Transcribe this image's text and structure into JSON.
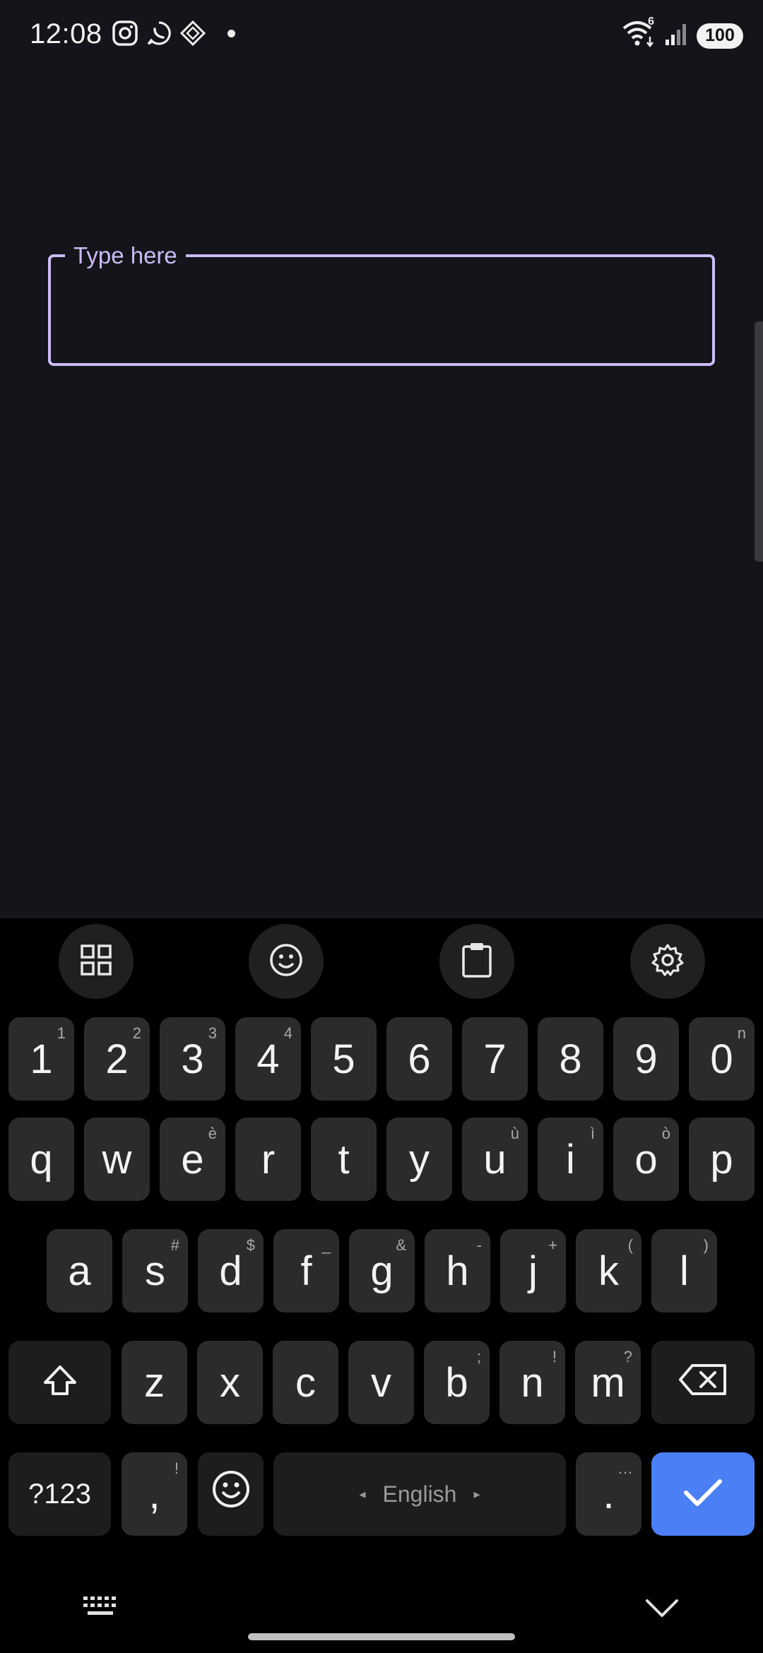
{
  "status_bar": {
    "time": "12:08",
    "battery": "100",
    "wifi_badge": "6",
    "left_icons": [
      "instagram-icon",
      "whatsapp-icon",
      "diamond-app-icon",
      "notification-dot"
    ],
    "right_icons": [
      "wifi-icon",
      "signal-icon",
      "battery-icon"
    ]
  },
  "text_field": {
    "label": "Type here",
    "value": ""
  },
  "keyboard": {
    "toolbar": [
      "grid-icon",
      "emoji-icon",
      "clipboard-icon",
      "settings-icon"
    ],
    "row_numbers": [
      {
        "label": "1",
        "hint": "1"
      },
      {
        "label": "2",
        "hint": "2"
      },
      {
        "label": "3",
        "hint": "3"
      },
      {
        "label": "4",
        "hint": "4"
      },
      {
        "label": "5",
        "hint": ""
      },
      {
        "label": "6",
        "hint": ""
      },
      {
        "label": "7",
        "hint": ""
      },
      {
        "label": "8",
        "hint": ""
      },
      {
        "label": "9",
        "hint": ""
      },
      {
        "label": "0",
        "hint": "n"
      }
    ],
    "row_top": [
      {
        "label": "q",
        "hint": ""
      },
      {
        "label": "w",
        "hint": ""
      },
      {
        "label": "e",
        "hint": "è"
      },
      {
        "label": "r",
        "hint": ""
      },
      {
        "label": "t",
        "hint": ""
      },
      {
        "label": "y",
        "hint": ""
      },
      {
        "label": "u",
        "hint": "ù"
      },
      {
        "label": "i",
        "hint": "ì"
      },
      {
        "label": "o",
        "hint": "ò"
      },
      {
        "label": "p",
        "hint": ""
      }
    ],
    "row_middle": [
      {
        "label": "a",
        "hint": ""
      },
      {
        "label": "s",
        "hint": "#"
      },
      {
        "label": "d",
        "hint": "$"
      },
      {
        "label": "f",
        "hint": "_"
      },
      {
        "label": "g",
        "hint": "&"
      },
      {
        "label": "h",
        "hint": "-"
      },
      {
        "label": "j",
        "hint": "+"
      },
      {
        "label": "k",
        "hint": "("
      },
      {
        "label": "l",
        "hint": ")"
      }
    ],
    "row_bottom": [
      {
        "label": "z",
        "hint": ""
      },
      {
        "label": "x",
        "hint": ""
      },
      {
        "label": "c",
        "hint": ""
      },
      {
        "label": "v",
        "hint": ""
      },
      {
        "label": "b",
        "hint": ";"
      },
      {
        "label": "n",
        "hint": "!"
      },
      {
        "label": "m",
        "hint": "?"
      }
    ],
    "symbols_key": "?123",
    "comma_key": ",",
    "comma_hint": "!",
    "period_key": ".",
    "period_hint": "…",
    "space_label": "English",
    "space_arrow_left": "◂",
    "space_arrow_right": "▸",
    "accent_color": "#4a7ff5"
  }
}
